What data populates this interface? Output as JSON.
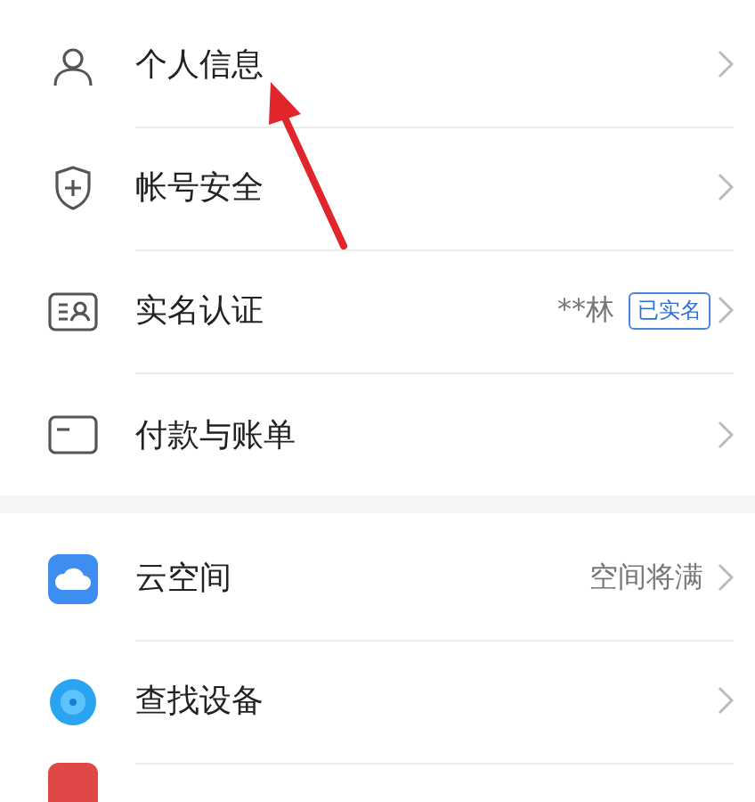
{
  "groups": [
    {
      "items": [
        {
          "label": "个人信息"
        },
        {
          "label": "帐号安全"
        },
        {
          "label": "实名认证",
          "value": "**林",
          "badge": "已实名"
        },
        {
          "label": "付款与账单"
        }
      ]
    },
    {
      "items": [
        {
          "label": "云空间",
          "value": "空间将满"
        },
        {
          "label": "查找设备"
        },
        {
          "kind": "cut-off"
        }
      ]
    }
  ],
  "annotation": {
    "kind": "arrow"
  }
}
